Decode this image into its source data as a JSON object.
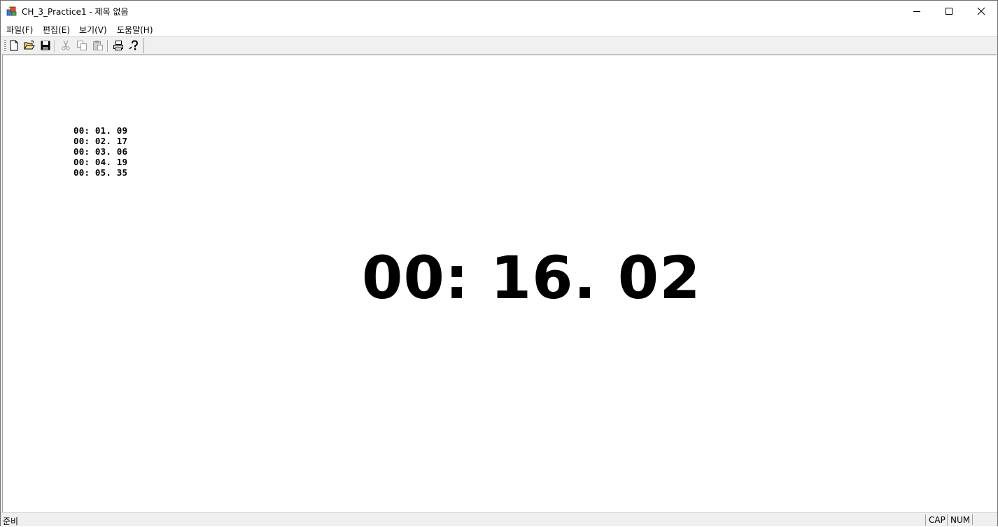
{
  "window": {
    "title": "CH_3_Practice1 - 제목 없음",
    "app_icon": "mfc-app-icon",
    "controls": [
      "minimize-icon",
      "maximize-icon",
      "close-icon"
    ]
  },
  "menu": {
    "file": "파일(F)",
    "edit": "편집(E)",
    "view": "보기(V)",
    "help": "도움말(H)"
  },
  "toolbar": {
    "buttons": [
      "new-icon",
      "open-icon",
      "save-icon",
      "cut-icon",
      "copy-icon",
      "paste-icon",
      "print-icon",
      "help-icon"
    ],
    "disabled": [
      "cut-icon",
      "copy-icon",
      "paste-icon"
    ]
  },
  "laps": [
    "00: 01. 09",
    "00: 02. 17",
    "00: 03. 06",
    "00: 04. 19",
    "00: 05. 35"
  ],
  "timer": "00: 16. 02",
  "status": {
    "message": "준비",
    "cap": "CAP",
    "num": "NUM"
  }
}
